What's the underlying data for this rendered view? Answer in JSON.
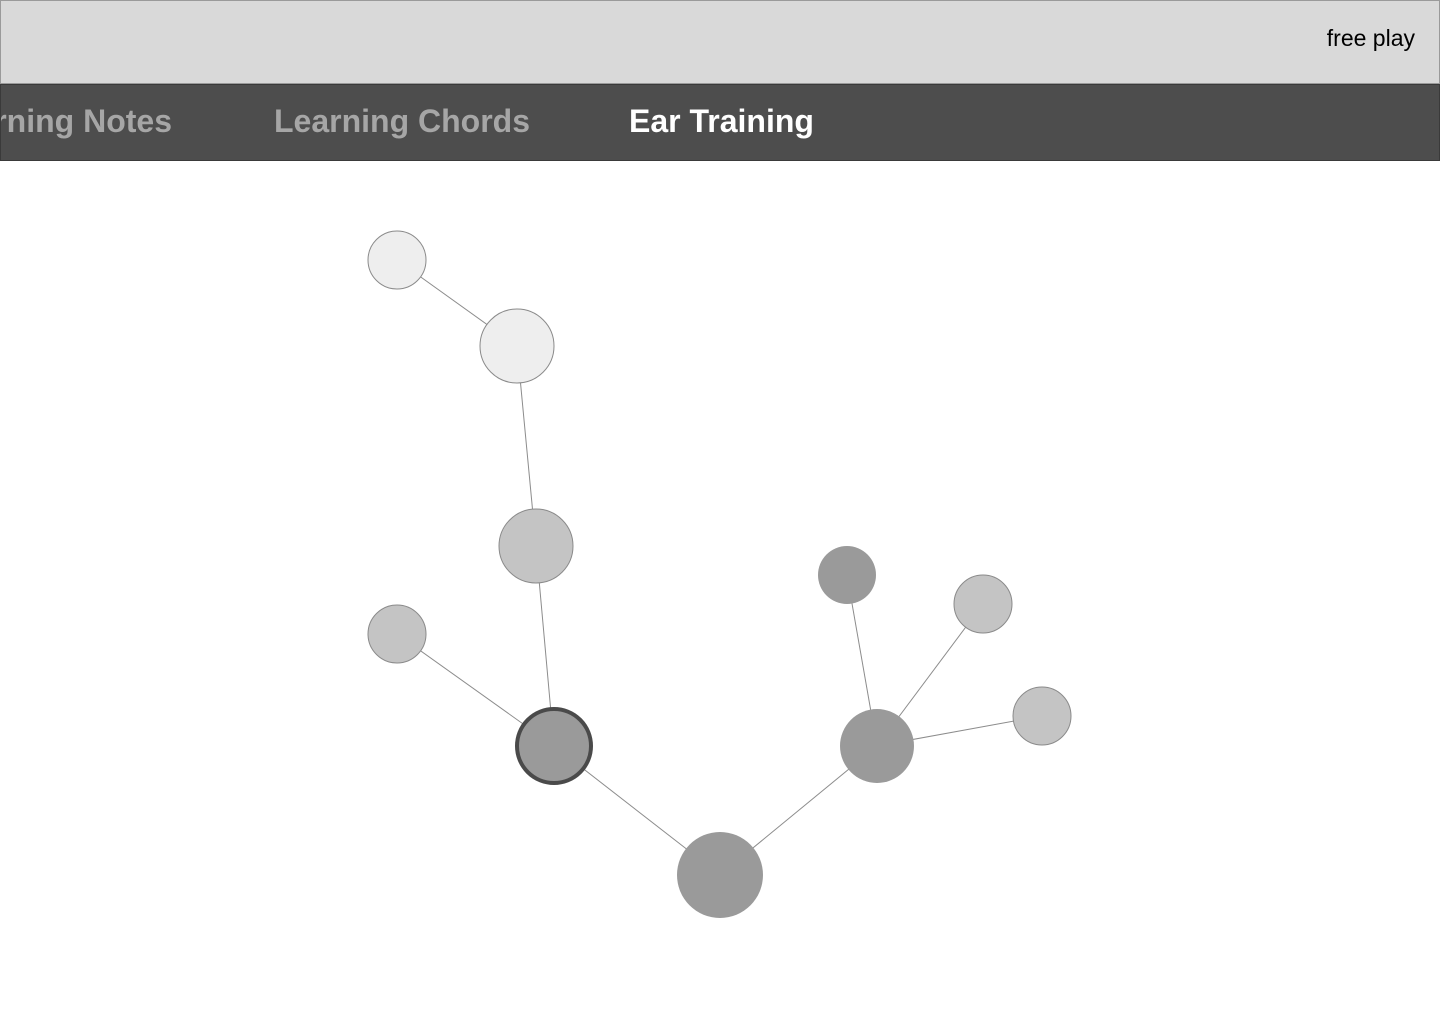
{
  "header": {
    "free_play_label": "free play"
  },
  "tabs": [
    {
      "label": "Learning Notes",
      "active": false
    },
    {
      "label": "Learning Chords",
      "active": false
    },
    {
      "label": "Ear Training",
      "active": true
    }
  ],
  "colors": {
    "header_bg": "#d9d9d9",
    "tabbar_bg": "#4d4d4d",
    "tab_inactive": "#a6a6a6",
    "tab_active": "#ffffff",
    "node_light": "#eeeeee",
    "node_mid": "#c4c4c4",
    "node_dark": "#9a9a9a",
    "node_selected_border": "#4a4a4a",
    "edge": "#8c8c8c"
  },
  "skill_tree": {
    "nodes": [
      {
        "id": "root",
        "shade": "dark",
        "selected": false
      },
      {
        "id": "left-branch",
        "shade": "dark",
        "selected": true
      },
      {
        "id": "left-leaf",
        "shade": "mid",
        "selected": false
      },
      {
        "id": "left-mid",
        "shade": "mid",
        "selected": false
      },
      {
        "id": "left-upper",
        "shade": "light",
        "selected": false
      },
      {
        "id": "left-top",
        "shade": "light",
        "selected": false
      },
      {
        "id": "right-branch",
        "shade": "dark",
        "selected": false
      },
      {
        "id": "right-top",
        "shade": "dark",
        "selected": false
      },
      {
        "id": "right-upper",
        "shade": "mid",
        "selected": false
      },
      {
        "id": "right-side",
        "shade": "mid",
        "selected": false
      }
    ],
    "edges": [
      [
        "root",
        "left-branch"
      ],
      [
        "root",
        "right-branch"
      ],
      [
        "left-branch",
        "left-leaf"
      ],
      [
        "left-branch",
        "left-mid"
      ],
      [
        "left-mid",
        "left-upper"
      ],
      [
        "left-upper",
        "left-top"
      ],
      [
        "right-branch",
        "right-top"
      ],
      [
        "right-branch",
        "right-upper"
      ],
      [
        "right-branch",
        "right-side"
      ]
    ]
  }
}
